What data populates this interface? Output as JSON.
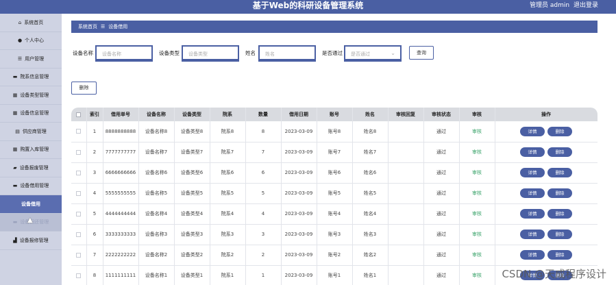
{
  "header": {
    "title": "基于Web的科研设备管理系统",
    "user_label": "管理员 admin",
    "logout": "退出登录"
  },
  "sidebar": {
    "items": [
      {
        "label": "系统首页",
        "icon": "home-icon",
        "glyph": "⌂"
      },
      {
        "label": "个人中心",
        "icon": "person-icon",
        "glyph": "●"
      },
      {
        "label": "用户管理",
        "icon": "list-icon",
        "glyph": "☰"
      },
      {
        "label": "院系信息管理",
        "icon": "monitor-icon",
        "glyph": "▬"
      },
      {
        "label": "设备类型管理",
        "icon": "grid-icon",
        "glyph": "▦"
      },
      {
        "label": "设备信息管理",
        "icon": "grid-icon",
        "glyph": "▦"
      },
      {
        "label": "供应商管理",
        "icon": "clipboard-icon",
        "glyph": "▤"
      },
      {
        "label": "购置入库管理",
        "icon": "grid-icon",
        "glyph": "▦"
      },
      {
        "label": "设备报废管理",
        "icon": "ticket-icon",
        "glyph": "▰"
      },
      {
        "label": "设备借用管理",
        "icon": "box-icon",
        "glyph": "▬"
      },
      {
        "label": "设备借用",
        "icon": "",
        "glyph": "",
        "type": "sub"
      },
      {
        "label": "设备归还管理",
        "icon": "box-icon",
        "glyph": "▬",
        "type": "ghost"
      },
      {
        "label": "设备报修管理",
        "icon": "wrench-icon",
        "glyph": "▟"
      }
    ]
  },
  "breadcrumb": {
    "home": "系统首页",
    "sep": "☰",
    "current": "设备借用"
  },
  "search": {
    "name_label": "设备名称",
    "name_placeholder": "设备名称",
    "type_label": "设备类型",
    "type_placeholder": "设备类型",
    "person_label": "姓名",
    "person_placeholder": "姓名",
    "pass_label": "是否通过",
    "pass_placeholder": "是否通过",
    "query_button": "查询"
  },
  "toolbar": {
    "delete_button": "删除"
  },
  "table": {
    "headers": [
      "",
      "索引",
      "借用单号",
      "设备名称",
      "设备类型",
      "院系",
      "数量",
      "借用日期",
      "账号",
      "姓名",
      "审核回复",
      "审核状态",
      "审核",
      "操作"
    ],
    "detail_label": "详情",
    "delete_label": "删除",
    "rows": [
      {
        "idx": "1",
        "code": "8888888888",
        "name": "设备名称8",
        "type": "设备类型8",
        "dept": "院系8",
        "qty": "8",
        "date": "2023-03-09",
        "account": "账号8",
        "person": "姓名8",
        "reply": "",
        "status": "通过",
        "audit": "审核"
      },
      {
        "idx": "2",
        "code": "7777777777",
        "name": "设备名称7",
        "type": "设备类型7",
        "dept": "院系7",
        "qty": "7",
        "date": "2023-03-09",
        "account": "账号7",
        "person": "姓名7",
        "reply": "",
        "status": "通过",
        "audit": "审核"
      },
      {
        "idx": "3",
        "code": "6666666666",
        "name": "设备名称6",
        "type": "设备类型6",
        "dept": "院系6",
        "qty": "6",
        "date": "2023-03-09",
        "account": "账号6",
        "person": "姓名6",
        "reply": "",
        "status": "通过",
        "audit": "审核"
      },
      {
        "idx": "4",
        "code": "5555555555",
        "name": "设备名称5",
        "type": "设备类型5",
        "dept": "院系5",
        "qty": "5",
        "date": "2023-03-09",
        "account": "账号5",
        "person": "姓名5",
        "reply": "",
        "status": "通过",
        "audit": "审核"
      },
      {
        "idx": "5",
        "code": "4444444444",
        "name": "设备名称4",
        "type": "设备类型4",
        "dept": "院系4",
        "qty": "4",
        "date": "2023-03-09",
        "account": "账号4",
        "person": "姓名4",
        "reply": "",
        "status": "通过",
        "audit": "审核"
      },
      {
        "idx": "6",
        "code": "3333333333",
        "name": "设备名称3",
        "type": "设备类型3",
        "dept": "院系3",
        "qty": "3",
        "date": "2023-03-09",
        "account": "账号3",
        "person": "姓名3",
        "reply": "",
        "status": "通过",
        "audit": "审核"
      },
      {
        "idx": "7",
        "code": "2222222222",
        "name": "设备名称2",
        "type": "设备类型2",
        "dept": "院系2",
        "qty": "2",
        "date": "2023-03-09",
        "account": "账号2",
        "person": "姓名2",
        "reply": "",
        "status": "通过",
        "audit": "审核"
      },
      {
        "idx": "8",
        "code": "1111111111",
        "name": "设备名称1",
        "type": "设备类型1",
        "dept": "院系1",
        "qty": "1",
        "date": "2023-03-09",
        "account": "账号1",
        "person": "姓名1",
        "reply": "",
        "status": "通过",
        "audit": "审核"
      }
    ]
  },
  "watermark": "CSDN @天成程序设计",
  "colors": {
    "primary": "#4a5fa3",
    "sidebar_bg": "#cfd3e3",
    "audit_green": "#3aa36a"
  }
}
